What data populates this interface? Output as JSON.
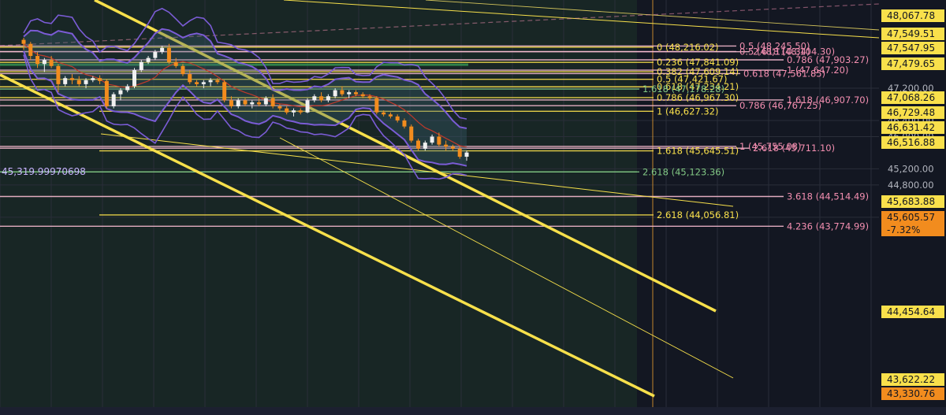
{
  "chart_data": {
    "type": "candlestick",
    "symbol_left_label": "45,319.99970698",
    "y_axis": {
      "range": [
        43200,
        48350
      ],
      "ticks": [
        "47,200.00",
        "46,400.00",
        "46,000.00",
        "45,200.00",
        "44,800.00",
        "44,000.00"
      ],
      "tick_values": [
        47200,
        46400,
        46000,
        45200,
        44800,
        44000
      ]
    },
    "price_tags": [
      {
        "text": "48,067.78",
        "value": 48067.78,
        "style": "yellow"
      },
      {
        "text": "47,549.51",
        "value": 47549.51,
        "style": "yellow"
      },
      {
        "text": "47,547.95",
        "value": 47547.95,
        "style": "yellow"
      },
      {
        "text": "47,479.65",
        "value": 47479.65,
        "style": "yellow"
      },
      {
        "text": "47,068.26",
        "value": 47068.26,
        "style": "yellow"
      },
      {
        "text": "46,729.48",
        "value": 46729.48,
        "style": "yellow"
      },
      {
        "text": "46,631.42",
        "value": 46631.42,
        "style": "yellow"
      },
      {
        "text": "46,516.88",
        "value": 46516.88,
        "style": "yellow"
      },
      {
        "text": "45,683.88",
        "value": 45683.88,
        "style": "yellow"
      },
      {
        "text": "45,605.57",
        "value": 45605.57,
        "style": "current",
        "change": "-7.32%"
      },
      {
        "text": "44,454.64",
        "value": 44454.64,
        "style": "yellow"
      },
      {
        "text": "43,622.22",
        "value": 43622.22,
        "style": "yellow"
      },
      {
        "text": "43,330.76",
        "value": 43330.76,
        "style": "orange"
      }
    ],
    "fib_levels": [
      {
        "label": "0.5 (48,245.50)",
        "value": 48245.5,
        "color": "#f8bbd0",
        "text_color": "#f48fb1"
      },
      {
        "label": "0 (48,216.02)",
        "value": 48216.02,
        "color": "#f9e04b",
        "text_color": "#f9e04b"
      },
      {
        "label": "0.5 (48,110.34)",
        "value": 48110.34,
        "color": "#f8bbd0",
        "text_color": "#f48fb1"
      },
      {
        "label": "2.618 (48,104.30)",
        "value": 48104.3,
        "color": "#f8bbd0",
        "text_color": "#f48fb1"
      },
      {
        "label": "0.786 (47,903.27)",
        "value": 47903.27,
        "color": "#f8bbd0",
        "text_color": "#f48fb1"
      },
      {
        "label": "0.236 (47,841.09)",
        "value": 47841.09,
        "color": "#f9e04b",
        "text_color": "#f9e04b"
      },
      {
        "label": "1 (47,647.20)",
        "value": 47647.2,
        "color": "#f8bbd0",
        "text_color": "#f48fb1"
      },
      {
        "label": "0.382 (47,609.14)",
        "value": 47609.14,
        "color": "#f9e04b",
        "text_color": "#f9e04b"
      },
      {
        "label": "0.618 (47,561.85)",
        "value": 47561.85,
        "color": "#f8bbd0",
        "text_color": "#f48fb1"
      },
      {
        "label": "0.5 (47,421.67)",
        "value": 47421.67,
        "color": "#f9e04b",
        "text_color": "#f9e04b"
      },
      {
        "label": "0.618 (47,234.21)",
        "value": 47234.21,
        "color": "#f9e04b",
        "text_color": "#f9e04b"
      },
      {
        "label": "1.618 (47,178.28)",
        "value": 47178.28,
        "color": "#81c784",
        "text_color": "#81c784"
      },
      {
        "label": "0.786 (46,967.30)",
        "value": 46967.3,
        "color": "#f9e04b",
        "text_color": "#f9e04b"
      },
      {
        "label": "1.618 (46,907.70)",
        "value": 46907.7,
        "color": "#f8bbd0",
        "text_color": "#f48fb1"
      },
      {
        "label": "0.786 (46,767.25)",
        "value": 46767.25,
        "color": "#f8bbd0",
        "text_color": "#f48fb1"
      },
      {
        "label": "1 (46,627.32)",
        "value": 46627.32,
        "color": "#f9e04b",
        "text_color": "#f9e04b"
      },
      {
        "label": "1 (45,755.08)",
        "value": 45755.08,
        "color": "#f8bbd0",
        "text_color": "#f48fb1"
      },
      {
        "label": "2.618 (45,711.10)",
        "value": 45711.1,
        "color": "#f8bbd0",
        "text_color": "#f48fb1"
      },
      {
        "label": "1.618 (45,645.51)",
        "value": 45645.51,
        "color": "#f9e04b",
        "text_color": "#f9e04b"
      },
      {
        "label": "2.618 (45,123.36)",
        "value": 45123.36,
        "color": "#81c784",
        "text_color": "#81c784"
      },
      {
        "label": "3.618 (44,514.49)",
        "value": 44514.49,
        "color": "#f8bbd0",
        "text_color": "#f48fb1"
      },
      {
        "label": "2.618 (44,056.81)",
        "value": 44056.81,
        "color": "#f9e04b",
        "text_color": "#f9e04b"
      },
      {
        "label": "4.236 (43,774.99)",
        "value": 43774.99,
        "color": "#f8bbd0",
        "text_color": "#f48fb1"
      }
    ],
    "candles": [
      [
        48400,
        48450,
        48150,
        48300
      ],
      [
        48300,
        48350,
        47900,
        48000
      ],
      [
        48000,
        48100,
        47700,
        47800
      ],
      [
        47800,
        47950,
        47600,
        47900
      ],
      [
        47900,
        48000,
        47700,
        47750
      ],
      [
        47750,
        47800,
        47100,
        47300
      ],
      [
        47300,
        47500,
        47250,
        47450
      ],
      [
        47450,
        47550,
        47300,
        47400
      ],
      [
        47400,
        47500,
        47250,
        47300
      ],
      [
        47300,
        47450,
        47200,
        47400
      ],
      [
        47400,
        47500,
        47350,
        47450
      ],
      [
        47450,
        47520,
        47300,
        47380
      ],
      [
        47380,
        47420,
        46700,
        46750
      ],
      [
        46750,
        47100,
        46700,
        47050
      ],
      [
        47050,
        47200,
        46900,
        47150
      ],
      [
        47150,
        47300,
        47100,
        47250
      ],
      [
        47250,
        47700,
        47200,
        47650
      ],
      [
        47650,
        47900,
        47600,
        47850
      ],
      [
        47850,
        48000,
        47800,
        47950
      ],
      [
        47950,
        48150,
        47900,
        48100
      ],
      [
        48100,
        48250,
        48050,
        48200
      ],
      [
        48200,
        48300,
        47800,
        47850
      ],
      [
        47850,
        47950,
        47700,
        47750
      ],
      [
        47750,
        47800,
        47500,
        47550
      ],
      [
        47550,
        47650,
        47300,
        47350
      ],
      [
        47350,
        47400,
        47250,
        47300
      ],
      [
        47300,
        47400,
        47200,
        47350
      ],
      [
        47350,
        47450,
        47250,
        47400
      ],
      [
        47400,
        47450,
        47300,
        47350
      ],
      [
        47350,
        47400,
        46850,
        46900
      ],
      [
        46900,
        47000,
        46700,
        46750
      ],
      [
        46750,
        46950,
        46700,
        46900
      ],
      [
        46900,
        46950,
        46750,
        46800
      ],
      [
        46800,
        46900,
        46700,
        46850
      ],
      [
        46850,
        46950,
        46750,
        46800
      ],
      [
        46800,
        47000,
        46750,
        46950
      ],
      [
        46950,
        47050,
        46700,
        46750
      ],
      [
        46750,
        46800,
        46650,
        46700
      ],
      [
        46700,
        46750,
        46550,
        46600
      ],
      [
        46600,
        46700,
        46500,
        46650
      ],
      [
        46650,
        46700,
        46550,
        46600
      ],
      [
        46600,
        46950,
        46580,
        46900
      ],
      [
        46900,
        47050,
        46850,
        47000
      ],
      [
        47000,
        47100,
        46850,
        46900
      ],
      [
        46900,
        47050,
        46850,
        47000
      ],
      [
        47000,
        47200,
        46950,
        47150
      ],
      [
        47150,
        47250,
        47000,
        47050
      ],
      [
        47050,
        47150,
        46950,
        47100
      ],
      [
        47100,
        47150,
        47000,
        47050
      ],
      [
        47050,
        47100,
        46950,
        47000
      ],
      [
        47000,
        47050,
        46900,
        46950
      ],
      [
        46950,
        47000,
        46550,
        46600
      ],
      [
        46600,
        46650,
        46500,
        46550
      ],
      [
        46550,
        46600,
        46450,
        46500
      ],
      [
        46500,
        46550,
        46350,
        46400
      ],
      [
        46400,
        46450,
        46200,
        46250
      ],
      [
        46250,
        46300,
        45850,
        45900
      ],
      [
        45900,
        45950,
        45650,
        45700
      ],
      [
        45700,
        45900,
        45650,
        45850
      ],
      [
        45850,
        46050,
        45800,
        46000
      ],
      [
        46000,
        46100,
        45750,
        45800
      ],
      [
        45800,
        45900,
        45650,
        45750
      ],
      [
        45750,
        45800,
        45650,
        45700
      ],
      [
        45700,
        45750,
        45450,
        45500
      ],
      [
        45500,
        45650,
        45400,
        45605
      ]
    ]
  }
}
